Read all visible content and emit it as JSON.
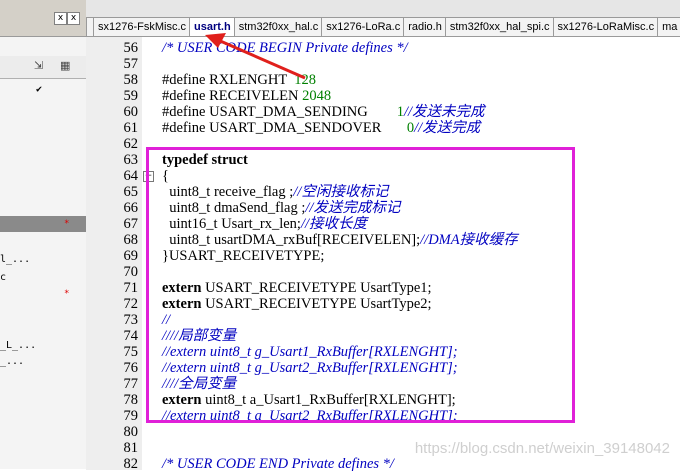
{
  "tabs": [
    {
      "label": "sx1276-FskMisc.c",
      "active": false
    },
    {
      "label": "usart.h",
      "active": true
    },
    {
      "label": "stm32f0xx_hal.c",
      "active": false
    },
    {
      "label": "sx1276-LoRa.c",
      "active": false
    },
    {
      "label": "radio.h",
      "active": false
    },
    {
      "label": "stm32f0xx_hal_spi.c",
      "active": false
    },
    {
      "label": "sx1276-LoRaMisc.c",
      "active": false
    },
    {
      "label": "ma",
      "active": false
    }
  ],
  "left_panel": {
    "title_buttons": [
      "x",
      "x"
    ],
    "rows": [
      {
        "text": "",
        "mark": "check"
      },
      {
        "text": "",
        "mark": "star",
        "selected": true
      },
      {
        "text": "l_...",
        "mark": ""
      },
      {
        "text": "c",
        "mark": ""
      },
      {
        "text": "",
        "mark": "star"
      },
      {
        "text": "_L_...",
        "mark": ""
      },
      {
        "text": "_...",
        "mark": ""
      }
    ]
  },
  "code_lines": [
    {
      "n": "56",
      "parts": [
        {
          "t": "/* USER CODE BEGIN Private defines */",
          "c": "cmt"
        }
      ]
    },
    {
      "n": "57",
      "parts": []
    },
    {
      "n": "58",
      "parts": [
        {
          "t": "#define RXLENGHT  ",
          "c": "plain"
        },
        {
          "t": "128",
          "c": "num"
        }
      ]
    },
    {
      "n": "59",
      "parts": [
        {
          "t": "#define RECEIVELEN ",
          "c": "plain"
        },
        {
          "t": "2048",
          "c": "num"
        }
      ]
    },
    {
      "n": "60",
      "parts": [
        {
          "t": "#define USART_DMA_SENDING        ",
          "c": "plain"
        },
        {
          "t": "1",
          "c": "num"
        },
        {
          "t": "//发送未完成",
          "c": "cmt"
        }
      ]
    },
    {
      "n": "61",
      "parts": [
        {
          "t": "#define USART_DMA_SENDOVER       ",
          "c": "plain"
        },
        {
          "t": "0",
          "c": "num"
        },
        {
          "t": "//发送完成",
          "c": "cmt"
        }
      ]
    },
    {
      "n": "62",
      "parts": []
    },
    {
      "n": "63",
      "parts": [
        {
          "t": "typedef struct",
          "c": "kw"
        }
      ]
    },
    {
      "n": "64",
      "parts": [
        {
          "t": "{",
          "c": "plain"
        }
      ],
      "fold": true
    },
    {
      "n": "65",
      "parts": [
        {
          "t": "  uint8_t receive_flag ;",
          "c": "plain"
        },
        {
          "t": "//空闲接收标记",
          "c": "cmt"
        }
      ]
    },
    {
      "n": "66",
      "parts": [
        {
          "t": "  uint8_t dmaSend_flag ;",
          "c": "plain"
        },
        {
          "t": "//发送完成标记",
          "c": "cmt"
        }
      ]
    },
    {
      "n": "67",
      "parts": [
        {
          "t": "  uint16_t Usart_rx_len;",
          "c": "plain"
        },
        {
          "t": "//接收长度",
          "c": "cmt"
        }
      ]
    },
    {
      "n": "68",
      "parts": [
        {
          "t": "  uint8_t usartDMA_rxBuf[RECEIVELEN];",
          "c": "plain"
        },
        {
          "t": "//DMA接收缓存",
          "c": "cmt"
        }
      ]
    },
    {
      "n": "69",
      "parts": [
        {
          "t": "}USART_RECEIVETYPE;",
          "c": "plain"
        }
      ]
    },
    {
      "n": "70",
      "parts": []
    },
    {
      "n": "71",
      "parts": [
        {
          "t": "extern",
          "c": "kw"
        },
        {
          "t": " USART_RECEIVETYPE UsartType1;",
          "c": "plain"
        }
      ]
    },
    {
      "n": "72",
      "parts": [
        {
          "t": "extern",
          "c": "kw"
        },
        {
          "t": " USART_RECEIVETYPE UsartType2;",
          "c": "plain"
        }
      ]
    },
    {
      "n": "73",
      "parts": [
        {
          "t": "//",
          "c": "cmt"
        }
      ]
    },
    {
      "n": "74",
      "parts": [
        {
          "t": "////局部变量",
          "c": "cmt"
        }
      ]
    },
    {
      "n": "75",
      "parts": [
        {
          "t": "//extern uint8_t g_Usart1_RxBuffer[RXLENGHT];",
          "c": "cmt"
        }
      ]
    },
    {
      "n": "76",
      "parts": [
        {
          "t": "//extern uint8_t g_Usart2_RxBuffer[RXLENGHT];",
          "c": "cmt"
        }
      ]
    },
    {
      "n": "77",
      "parts": [
        {
          "t": "////全局变量",
          "c": "cmt"
        }
      ]
    },
    {
      "n": "78",
      "parts": [
        {
          "t": "extern",
          "c": "kw"
        },
        {
          "t": " uint8_t a_Usart1_RxBuffer[RXLENGHT];",
          "c": "plain"
        }
      ]
    },
    {
      "n": "79",
      "parts": [
        {
          "t": "//extern uint8_t a_Usart2_RxBuffer[RXLENGHT];",
          "c": "cmt"
        }
      ]
    },
    {
      "n": "80",
      "parts": []
    },
    {
      "n": "81",
      "parts": []
    },
    {
      "n": "82",
      "parts": [
        {
          "t": "/* USER CODE END Private defines */",
          "c": "cmt"
        }
      ]
    }
  ],
  "watermark": "https://blog.csdn.net/weixin_39148042",
  "colors": {
    "highlight_box": "#e020d8",
    "arrow": "#e0201c",
    "comment": "#0000c0",
    "number": "#008000"
  },
  "icons": [
    "close-icon",
    "fold-minus-icon",
    "check-icon",
    "star-icon",
    "arrow-annotation"
  ]
}
